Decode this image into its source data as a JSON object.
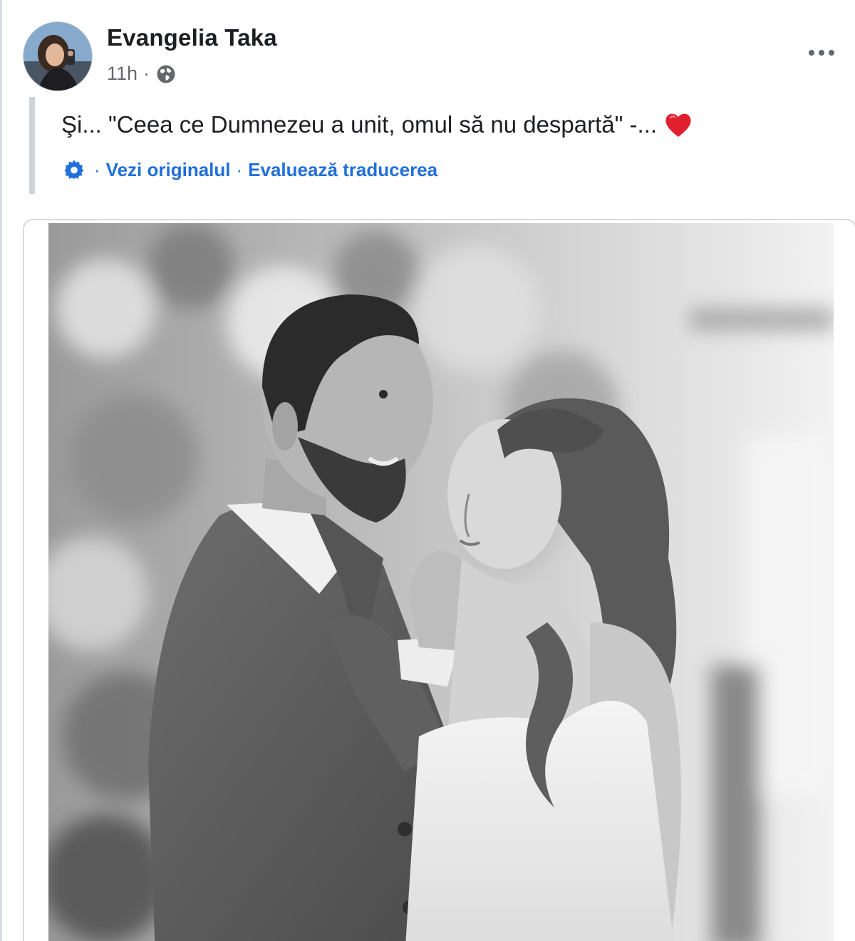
{
  "post": {
    "author_name": "Evangelia Taka",
    "timestamp": "11h",
    "separator": "·",
    "audience_icon": "globe-icon",
    "more_icon": "more-options-icon",
    "text": "Şi... \"Ceea ce Dumnezeu a unit, omul să nu despartă\" -...",
    "reaction_emoji_icon": "red-heart-icon",
    "translation": {
      "settings_icon": "gear-icon",
      "separator": "·",
      "see_original_label": "Vezi originalul",
      "rate_translation_label": "Evaluează traducerea"
    },
    "photo_icon": "photo"
  },
  "colors": {
    "link_blue": "#216fdb",
    "heart_red": "#e0202e",
    "text_dark": "#1c1e21",
    "meta_gray": "#65676b"
  }
}
